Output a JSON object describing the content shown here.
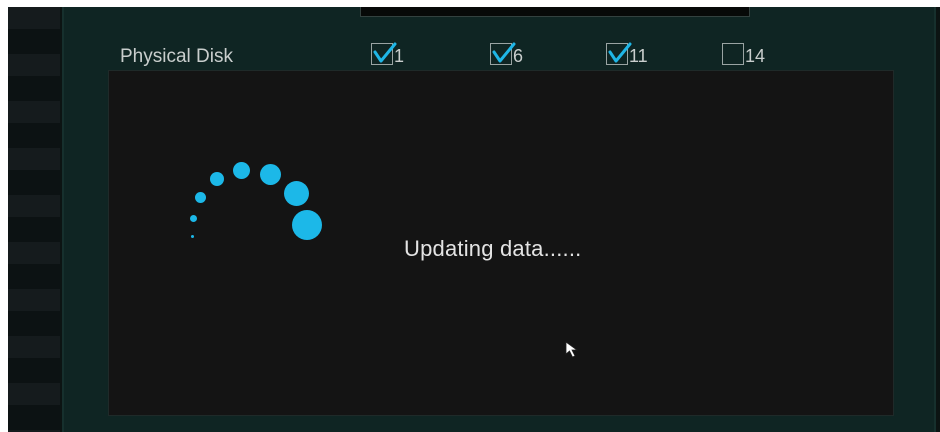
{
  "physical_disk": {
    "label": "Physical Disk",
    "disks": [
      {
        "number": "1",
        "checked": true
      },
      {
        "number": "6",
        "checked": true
      },
      {
        "number": "11",
        "checked": true
      },
      {
        "number": "14",
        "checked": false
      }
    ]
  },
  "loading": {
    "message": "Updating data......",
    "spinner_icon": "loading-spinner-icon",
    "accent_color": "#1cb8e8"
  },
  "cursor_icon": "mouse-pointer-icon"
}
